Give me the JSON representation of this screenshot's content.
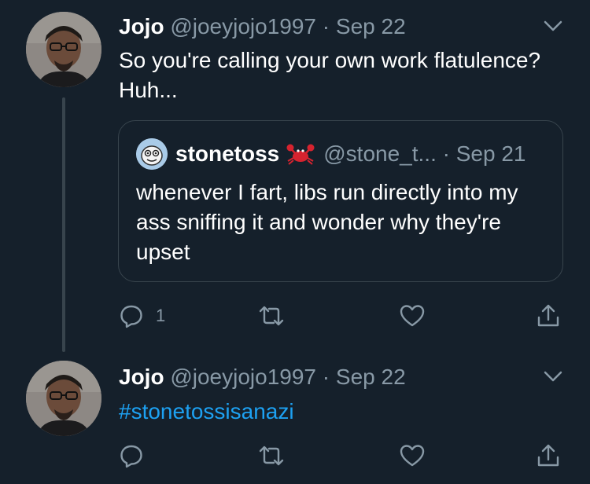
{
  "colors": {
    "background": "#15202b",
    "text": "#ffffff",
    "secondary": "#8899a6",
    "link": "#1da1f2",
    "border": "#38444d"
  },
  "tweets": [
    {
      "name": "Jojo",
      "handle": "@joeyjojo1997",
      "separator": "·",
      "date": "Sep 22",
      "text": "So you're calling your own work flatulence? Huh...",
      "quote": {
        "name": "stonetoss",
        "handle": "@stone_t...",
        "separator": "·",
        "date": "Sep 21",
        "text": "whenever I fart, libs run directly into my ass sniffing it and wonder why they're upset"
      },
      "actions": {
        "reply_count": "1",
        "icons": [
          "reply-icon",
          "retweet-icon",
          "like-icon",
          "share-icon"
        ]
      }
    },
    {
      "name": "Jojo",
      "handle": "@joeyjojo1997",
      "separator": "·",
      "date": "Sep 22",
      "text": "#stonetossisanazi",
      "actions": {
        "icons": [
          "reply-icon",
          "retweet-icon",
          "like-icon",
          "share-icon"
        ]
      }
    }
  ]
}
